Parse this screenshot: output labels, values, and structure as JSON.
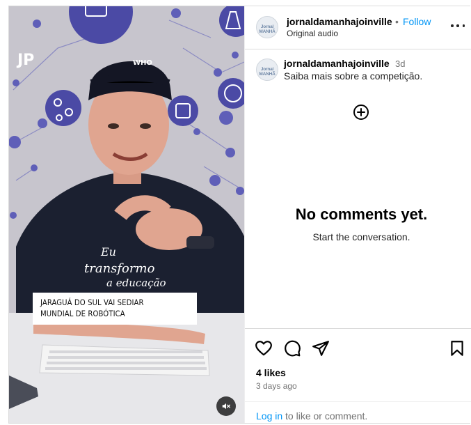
{
  "post": {
    "author": "jornaldamanhajoinville",
    "follow_label": "Follow",
    "separator": "•",
    "audio_label": "Original audio",
    "avatar_text": "Jornal MANHÃ"
  },
  "video": {
    "caption_line1": "JARAGUÁ DO SUL VAI SEDIAR",
    "caption_line2": "MUNDIAL DE ROBÓTICA",
    "logo_text": "JP",
    "cap_text_line1": "WHO",
    "shirt_text_line1": "Eu",
    "shirt_text_line2": "transformo",
    "shirt_text_line3": "a educação"
  },
  "caption": {
    "user": "jornaldamanhajoinville",
    "time": "3d",
    "text": "Saiba mais sobre a competição."
  },
  "comments": {
    "empty_title": "No comments yet.",
    "empty_subtitle": "Start the conversation."
  },
  "footer": {
    "likes": "4 likes",
    "ago": "3 days ago",
    "login_link": "Log in",
    "login_rest": " to like or comment."
  },
  "icons": {
    "more": "more-options-icon",
    "add": "add-circle-icon",
    "like": "heart-icon",
    "comment": "comment-icon",
    "share": "share-icon",
    "save": "bookmark-icon",
    "mute": "muted-speaker-icon"
  }
}
